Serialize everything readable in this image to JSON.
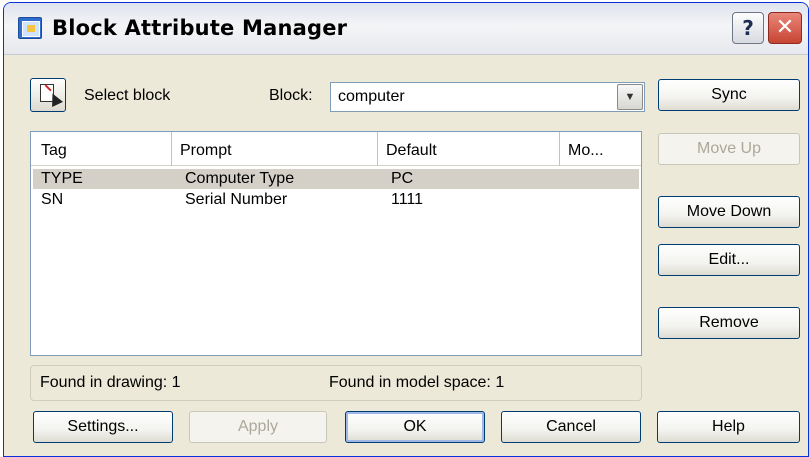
{
  "window": {
    "title": "Block Attribute Manager",
    "help_label": "?",
    "close_label": "✕"
  },
  "toolbar": {
    "select_block_label": "Select block",
    "block_label": "Block:",
    "block_value": "computer"
  },
  "side_buttons": {
    "sync": "Sync",
    "move_up": "Move Up",
    "move_down": "Move Down",
    "edit": "Edit...",
    "remove": "Remove"
  },
  "table": {
    "columns": [
      "Tag",
      "Prompt",
      "Default",
      "Mo..."
    ],
    "rows": [
      {
        "tag": "TYPE",
        "prompt": "Computer Type",
        "default": "PC",
        "selected": true
      },
      {
        "tag": "SN",
        "prompt": "Serial Number",
        "default": "1111",
        "selected": false
      }
    ]
  },
  "status": {
    "found_in_drawing": "Found in drawing: 1",
    "found_in_model_space": "Found in model space: 1"
  },
  "bottom_buttons": {
    "settings": "Settings...",
    "apply": "Apply",
    "ok": "OK",
    "cancel": "Cancel",
    "help": "Help"
  },
  "colors": {
    "dialog_bg": "#ece9d8",
    "selection": "#d4d0c8",
    "close_button": "#c74432",
    "disabled_text": "#aca899"
  }
}
